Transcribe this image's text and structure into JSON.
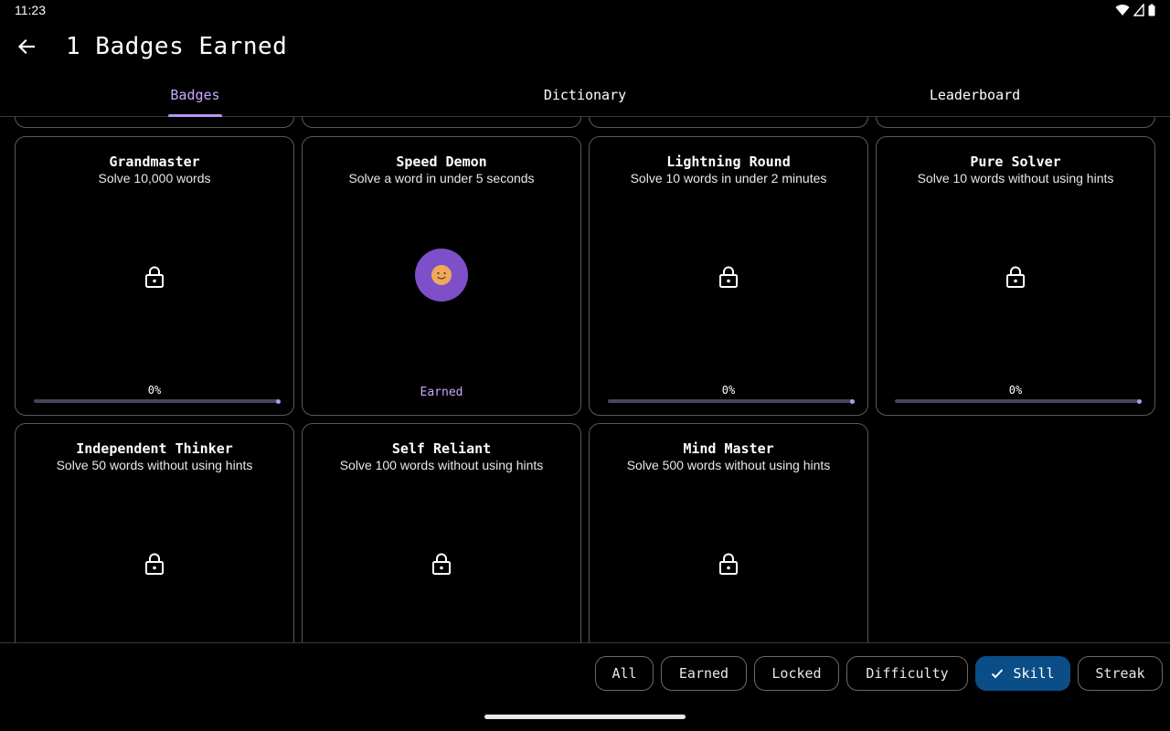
{
  "status": {
    "time": "11:23"
  },
  "header": {
    "title": "1 Badges Earned"
  },
  "tabs": [
    {
      "label": "Badges",
      "active": true
    },
    {
      "label": "Dictionary",
      "active": false
    },
    {
      "label": "Leaderboard",
      "active": false
    }
  ],
  "badges": [
    {
      "title": "Grandmaster",
      "desc": "Solve 10,000 words",
      "progress": "0%",
      "progress_value": 0
    },
    {
      "title": "Speed Demon",
      "desc": "Solve a word in under 5 seconds",
      "status": "Earned"
    },
    {
      "title": "Lightning Round",
      "desc": "Solve 10 words in under 2 minutes",
      "progress": "0%",
      "progress_value": 0
    },
    {
      "title": "Pure Solver",
      "desc": "Solve 10 words without using hints",
      "progress": "0%",
      "progress_value": 0
    },
    {
      "title": "Independent Thinker",
      "desc": "Solve 50 words without using hints"
    },
    {
      "title": "Self Reliant",
      "desc": "Solve 100 words without using hints"
    },
    {
      "title": "Mind Master",
      "desc": "Solve 500 words without using hints"
    }
  ],
  "filters": [
    {
      "label": "All",
      "selected": false
    },
    {
      "label": "Earned",
      "selected": false
    },
    {
      "label": "Locked",
      "selected": false
    },
    {
      "label": "Difficulty",
      "selected": false
    },
    {
      "label": "Skill",
      "selected": true
    },
    {
      "label": "Streak",
      "selected": false
    }
  ],
  "icons": {
    "back": "arrow-left-icon",
    "lock": "lock-icon",
    "check": "check-icon",
    "avatar": "smiley-face-icon"
  },
  "colors": {
    "accent": "#b598f0",
    "selected_chip": "#0b4d86",
    "avatar": "#7d4fc9"
  }
}
